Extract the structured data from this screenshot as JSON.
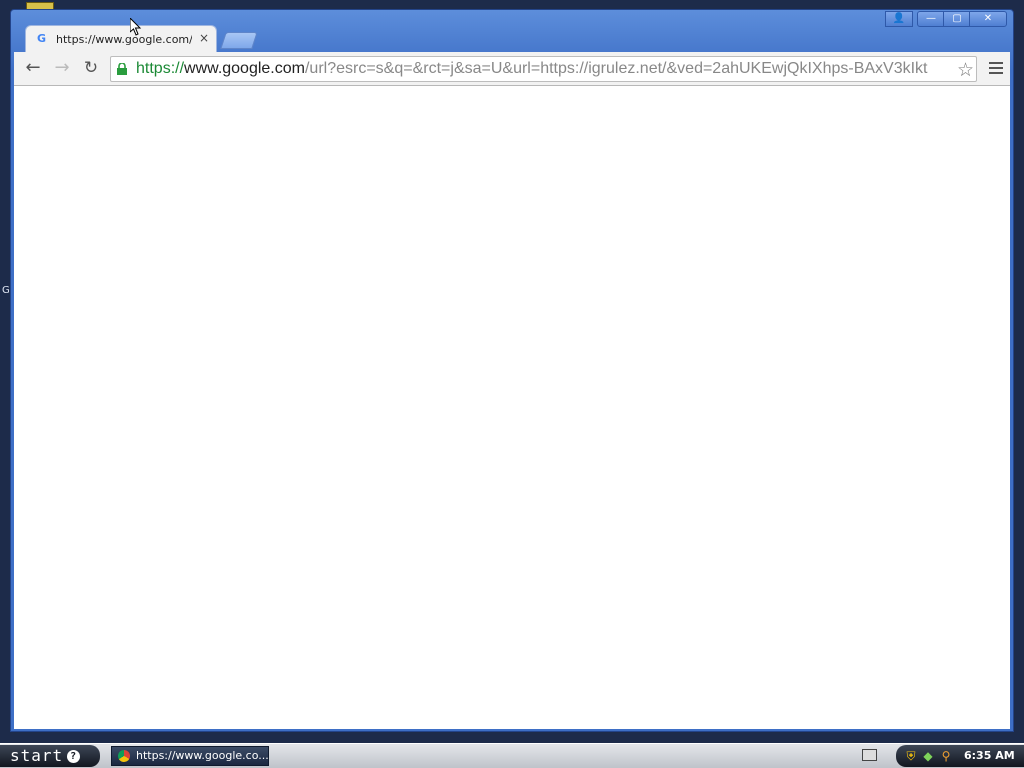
{
  "desktop": {
    "side_letter": "G"
  },
  "window": {
    "controls": {
      "user": "👤",
      "minimize": "—",
      "maximize": "▢",
      "close": "✕"
    }
  },
  "tab": {
    "favicon": "G",
    "title": "https://www.google.com/url",
    "close": "×"
  },
  "toolbar": {
    "back": "←",
    "forward": "→",
    "reload": "↻",
    "url_scheme": "https://",
    "url_host": "www.google.com",
    "url_rest": "/url?esrc=s&q=&rct=j&sa=U&url=https://igrulez.net/&ved=2ahUKEwjQkIXhps-BAxV3kIkt",
    "star": "☆"
  },
  "taskbar": {
    "start_label": "start",
    "start_orb": "?",
    "task_button_label": "https://www.google.co...",
    "clock": "6:35 AM"
  },
  "tray_icons": [
    "shield-icon",
    "network-icon",
    "search-icon"
  ],
  "colors": {
    "secure_green": "#1c8a36",
    "window_blue": "#3e6fc6"
  }
}
